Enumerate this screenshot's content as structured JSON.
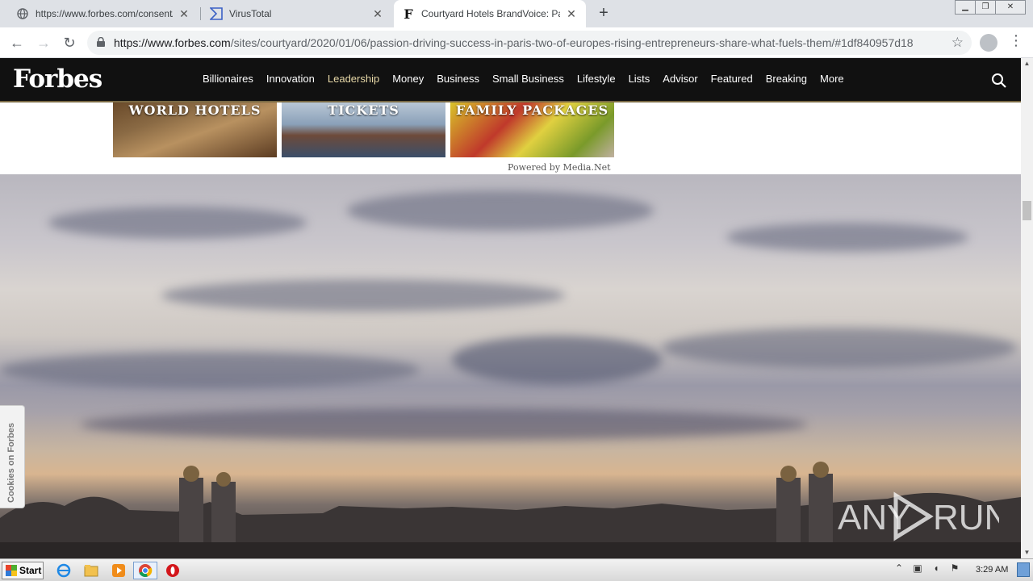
{
  "browser": {
    "tabs": [
      {
        "title": "https://www.forbes.com/consent/?t",
        "favicon": "globe-icon",
        "active": false
      },
      {
        "title": "VirusTotal",
        "favicon": "virustotal-icon",
        "active": false
      },
      {
        "title": "Courtyard Hotels BrandVoice: Passio",
        "favicon": "forbes-f-icon",
        "active": true
      }
    ],
    "new_tab_label": "+",
    "url_host": "https://www.forbes.com",
    "url_path": "/sites/courtyard/2020/01/06/passion-driving-success-in-paris-two-of-europes-rising-entrepreneurs-share-what-fuels-them/#1df840957d18"
  },
  "forbes": {
    "logo": "Forbes",
    "nav": [
      "Billionaires",
      "Innovation",
      "Leadership",
      "Money",
      "Business",
      "Small Business",
      "Lifestyle",
      "Lists",
      "Advisor",
      "Featured",
      "Breaking",
      "More"
    ],
    "active_nav": "Leadership"
  },
  "ads": {
    "tiles": [
      "WORLD HOTELS",
      "TICKETS",
      "FAMILY PACKAGES"
    ],
    "powered_by": "Powered by Media.Net"
  },
  "cookies_tab": "Cookies on Forbes",
  "watermark": "ANY RUN",
  "taskbar": {
    "start_label": "Start",
    "clock": "3:29 AM"
  }
}
